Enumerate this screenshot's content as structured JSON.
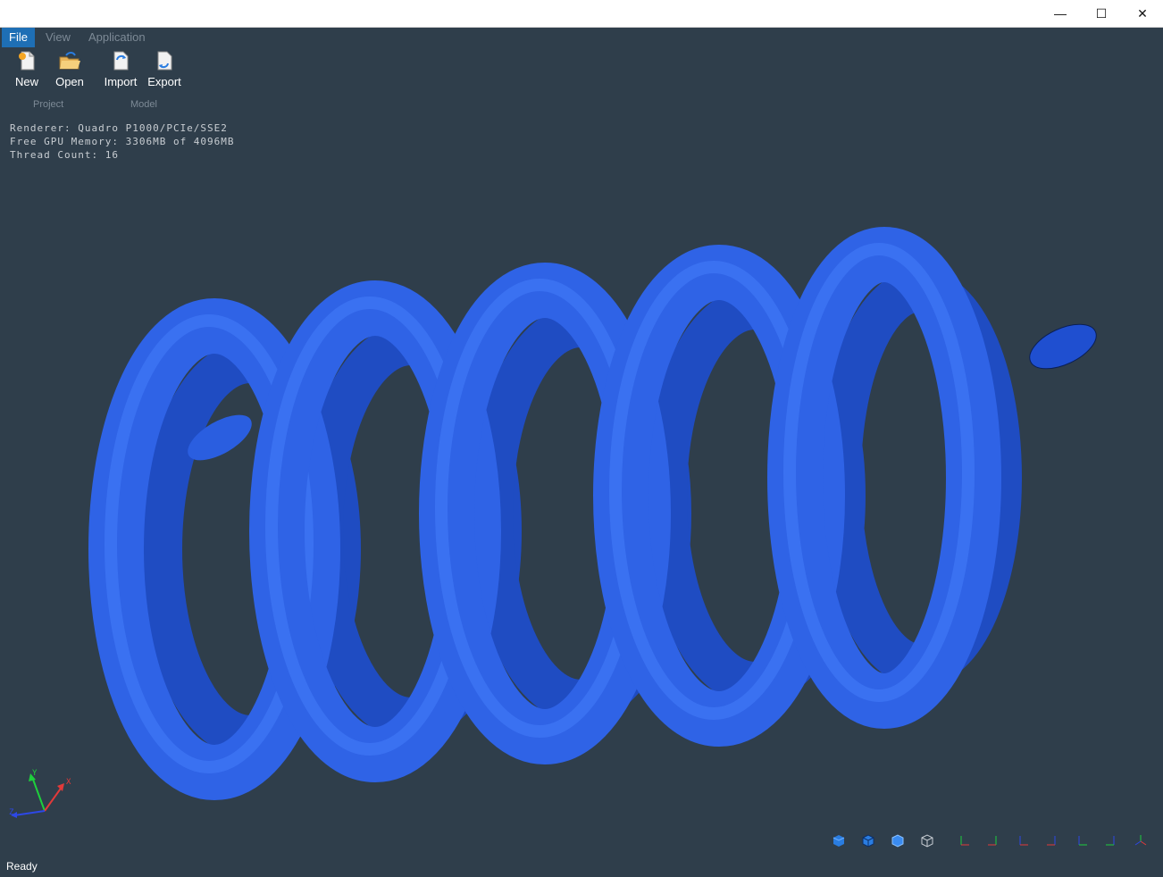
{
  "window": {
    "minimize": "—",
    "maximize": "☐",
    "close": "✕"
  },
  "menu": {
    "items": [
      "File",
      "View",
      "Application"
    ],
    "active": "File"
  },
  "toolbar": {
    "buttons": [
      {
        "label": "New",
        "icon": "new-file-icon"
      },
      {
        "label": "Open",
        "icon": "open-folder-icon"
      },
      {
        "label": "Import",
        "icon": "import-icon"
      },
      {
        "label": "Export",
        "icon": "export-icon"
      }
    ],
    "groups": [
      "Project",
      "Model"
    ]
  },
  "info": {
    "renderer": "Renderer: Quadro P1000/PCIe/SSE2",
    "memory": "Free GPU Memory: 3306MB of 4096MB",
    "threads": "Thread Count: 16"
  },
  "model": {
    "shape": "helical spring",
    "color": "#2f63e6",
    "coils": 4.5
  },
  "triad": {
    "x": "X",
    "y": "Y",
    "z": "Z"
  },
  "viewbar": {
    "shading_buttons": [
      "shaded-icon",
      "shaded-edges-icon",
      "shaded-cube-icon",
      "wireframe-icon"
    ],
    "orientation_buttons": [
      "view-front-icon",
      "view-back-icon",
      "view-top-icon",
      "view-bottom-icon",
      "view-left-icon",
      "view-right-icon",
      "view-iso-icon"
    ]
  },
  "status": {
    "text": "Ready"
  },
  "colors": {
    "background": "#2f3e4b",
    "accent": "#1e6fb5",
    "spring": "#2f63e6"
  }
}
